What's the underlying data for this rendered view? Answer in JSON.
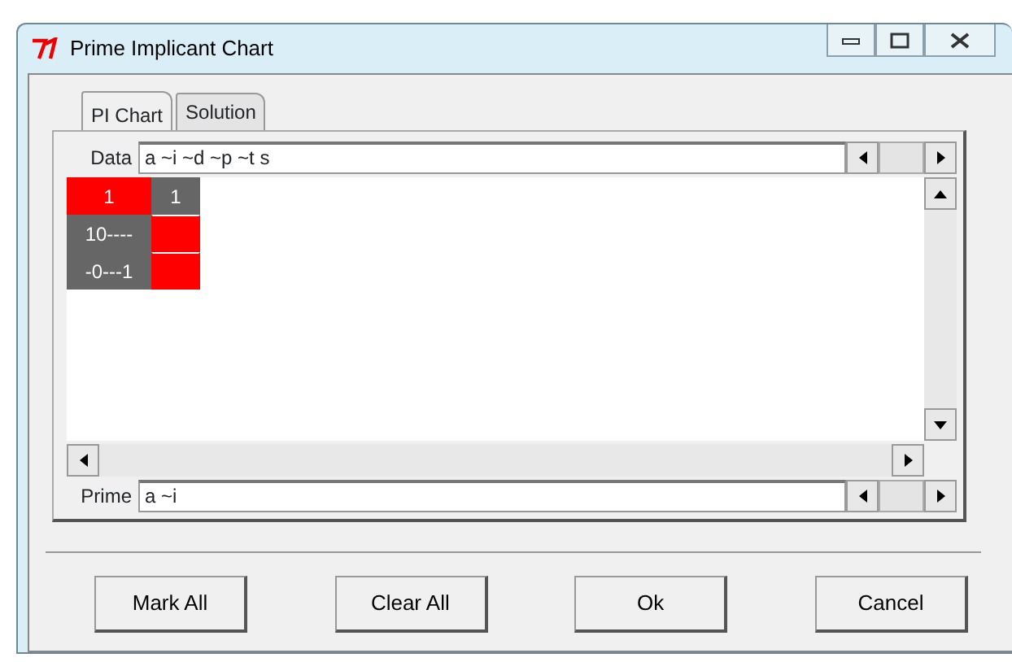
{
  "window": {
    "title": "Prime Implicant Chart"
  },
  "tabs": [
    {
      "label": "PI Chart",
      "selected": true
    },
    {
      "label": "Solution",
      "selected": false
    }
  ],
  "data_field": {
    "label": "Data",
    "value": "a ~i ~d ~p ~t s"
  },
  "chart": {
    "header": [
      {
        "text": "1",
        "marked": true
      },
      {
        "text": "1",
        "marked": false
      }
    ],
    "rows": [
      {
        "label": "10----",
        "cells": [
          {
            "marked": true
          }
        ]
      },
      {
        "label": "-0---1",
        "cells": [
          {
            "marked": true
          }
        ]
      }
    ]
  },
  "prime_field": {
    "label": "Prime",
    "value": "a ~i"
  },
  "buttons": [
    "Mark All",
    "Clear All",
    "Ok",
    "Cancel"
  ]
}
